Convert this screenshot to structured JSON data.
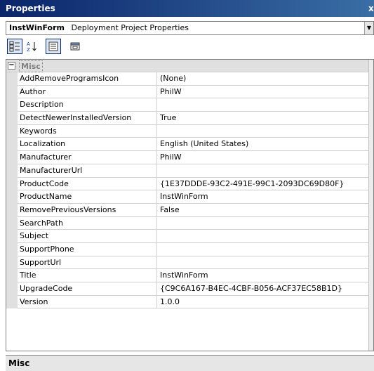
{
  "window": {
    "title": "Properties",
    "close_glyph": "x"
  },
  "object_selector": {
    "name": "InstWinForm",
    "type": "Deployment Project Properties"
  },
  "toolbar": {
    "buttons": [
      {
        "icon": "categorized-icon",
        "active": true
      },
      {
        "icon": "alphabetical-icon",
        "active": false
      },
      {
        "icon": "properties-icon",
        "active": true
      },
      {
        "icon": "property-pages-icon",
        "active": false
      }
    ]
  },
  "grid": {
    "category": {
      "toggle": "−",
      "label": "Misc"
    },
    "rows": [
      {
        "name": "AddRemoveProgramsIcon",
        "value": "(None)"
      },
      {
        "name": "Author",
        "value": "PhilW"
      },
      {
        "name": "Description",
        "value": ""
      },
      {
        "name": "DetectNewerInstalledVersion",
        "value": "True"
      },
      {
        "name": "Keywords",
        "value": ""
      },
      {
        "name": "Localization",
        "value": "English (United States)"
      },
      {
        "name": "Manufacturer",
        "value": "PhilW"
      },
      {
        "name": "ManufacturerUrl",
        "value": ""
      },
      {
        "name": "ProductCode",
        "value": "{1E37DDDE-93C2-491E-99C1-2093DC69D80F}"
      },
      {
        "name": "ProductName",
        "value": "InstWinForm"
      },
      {
        "name": "RemovePreviousVersions",
        "value": "False"
      },
      {
        "name": "SearchPath",
        "value": ""
      },
      {
        "name": "Subject",
        "value": ""
      },
      {
        "name": "SupportPhone",
        "value": ""
      },
      {
        "name": "SupportUrl",
        "value": ""
      },
      {
        "name": "Title",
        "value": "InstWinForm"
      },
      {
        "name": "UpgradeCode",
        "value": "{C9C6A167-B4EC-4CBF-B056-ACF37EC58B1D}"
      },
      {
        "name": "Version",
        "value": "1.0.0"
      }
    ]
  },
  "description_pane": {
    "title": "Misc"
  }
}
